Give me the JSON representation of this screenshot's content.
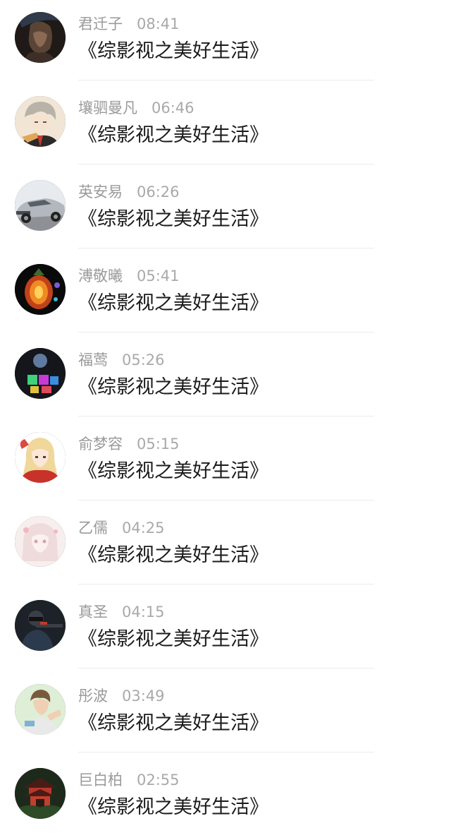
{
  "messages": [
    {
      "name": "君迁子",
      "time": "08:41",
      "text": "《综影视之美好生活》",
      "avatar": "dark-portrait-avatar"
    },
    {
      "name": "壤驷曼凡",
      "time": "06:46",
      "text": "《综影视之美好生活》",
      "avatar": "anime-boy-avatar"
    },
    {
      "name": "英安易",
      "time": "06:26",
      "text": "《综影视之美好生活》",
      "avatar": "silver-car-avatar"
    },
    {
      "name": "溥敬曦",
      "time": "05:41",
      "text": "《综影视之美好生活》",
      "avatar": "glowing-fruit-avatar"
    },
    {
      "name": "福莺",
      "time": "05:26",
      "text": "《综影视之美好生活》",
      "avatar": "colorful-lights-avatar"
    },
    {
      "name": "俞梦容",
      "time": "05:15",
      "text": "《综影视之美好生活》",
      "avatar": "anime-girl-avatar"
    },
    {
      "name": "乙儒",
      "time": "04:25",
      "text": "《综影视之美好生活》",
      "avatar": "pale-anime-girl-avatar"
    },
    {
      "name": "真圣",
      "time": "04:15",
      "text": "《综影视之美好生活》",
      "avatar": "soldier-avatar"
    },
    {
      "name": "彤波",
      "time": "03:49",
      "text": "《综影视之美好生活》",
      "avatar": "woman-fitness-avatar"
    },
    {
      "name": "巨白柏",
      "time": "02:55",
      "text": "《综影视之美好生活》",
      "avatar": "pagoda-avatar"
    }
  ]
}
